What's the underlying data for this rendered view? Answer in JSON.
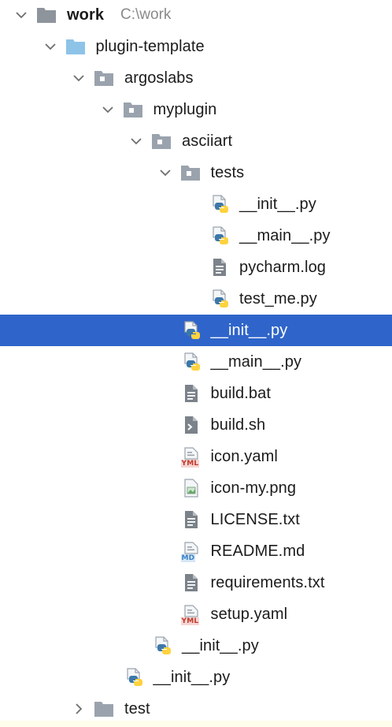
{
  "tree": [
    {
      "label": "work",
      "path": "C:\\work",
      "level": 0,
      "kind": "folder-root",
      "expanded": true,
      "bold": true
    },
    {
      "label": "plugin-template",
      "level": 1,
      "kind": "folder-module",
      "expanded": true
    },
    {
      "label": "argoslabs",
      "level": 2,
      "kind": "folder-package",
      "expanded": true
    },
    {
      "label": "myplugin",
      "level": 3,
      "kind": "folder-package",
      "expanded": true
    },
    {
      "label": "asciiart",
      "level": 4,
      "kind": "folder-package",
      "expanded": true
    },
    {
      "label": "tests",
      "level": 5,
      "kind": "folder-package",
      "expanded": true
    },
    {
      "label": "__init__.py",
      "level": 6,
      "kind": "python"
    },
    {
      "label": "__main__.py",
      "level": 6,
      "kind": "python"
    },
    {
      "label": "pycharm.log",
      "level": 6,
      "kind": "text"
    },
    {
      "label": "test_me.py",
      "level": 6,
      "kind": "python"
    },
    {
      "label": "__init__.py",
      "level": 5,
      "kind": "python",
      "selected": true
    },
    {
      "label": "__main__.py",
      "level": 5,
      "kind": "python"
    },
    {
      "label": "build.bat",
      "level": 5,
      "kind": "text"
    },
    {
      "label": "build.sh",
      "level": 5,
      "kind": "shell"
    },
    {
      "label": "icon.yaml",
      "level": 5,
      "kind": "yaml",
      "badge": "YML"
    },
    {
      "label": "icon-my.png",
      "level": 5,
      "kind": "image"
    },
    {
      "label": "LICENSE.txt",
      "level": 5,
      "kind": "text"
    },
    {
      "label": "README.md",
      "level": 5,
      "kind": "markdown",
      "badge": "MD"
    },
    {
      "label": "requirements.txt",
      "level": 5,
      "kind": "text"
    },
    {
      "label": "setup.yaml",
      "level": 5,
      "kind": "yaml",
      "badge": "YML"
    },
    {
      "label": "__init__.py",
      "level": 4,
      "kind": "python"
    },
    {
      "label": "__init__.py",
      "level": 3,
      "kind": "python"
    },
    {
      "label": "test",
      "level": 2,
      "kind": "folder-plain",
      "expanded": false
    }
  ],
  "colors": {
    "selection": "#2f65ca",
    "folder_gray": "#9aa3ad",
    "folder_blue": "#8ec3e8",
    "python_blue": "#3c78aa",
    "python_yellow": "#ffd23f",
    "yaml_red": "#c0392b",
    "md_blue": "#3b82c4"
  }
}
